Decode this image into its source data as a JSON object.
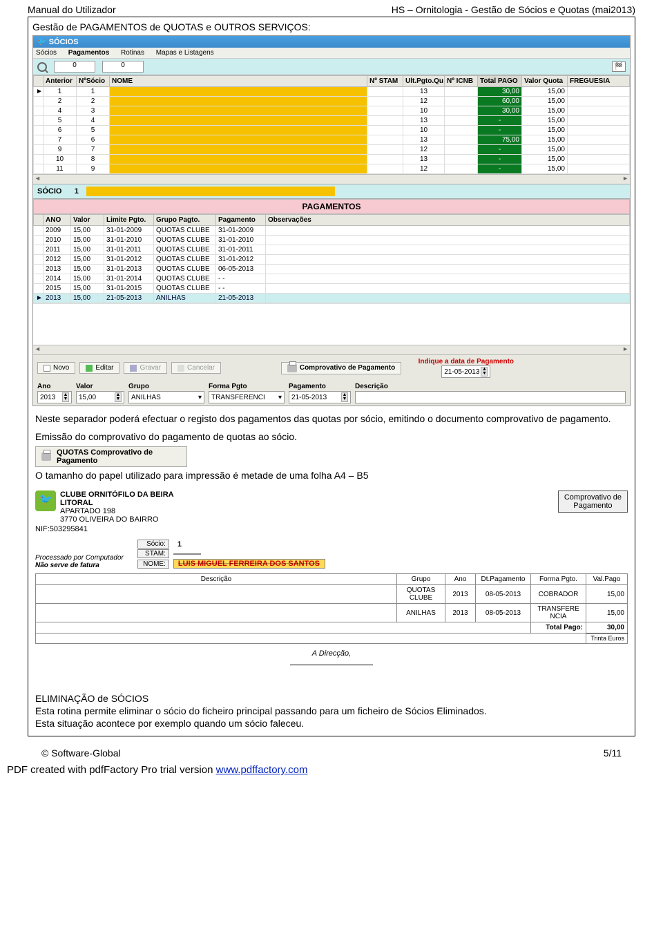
{
  "header": {
    "left": "Manual do Utilizador",
    "right": "HS – Ornitologia - Gestão de Sócios e Quotas (mai2013)"
  },
  "section_heading": "Gestão de PAGAMENTOS de QUOTAS e OUTROS SERVIÇOS:",
  "app": {
    "title": "SÓCIOS",
    "menus": [
      "Sócios",
      "Pagamentos",
      "Rotinas",
      "Mapas e Listagens"
    ],
    "filters": {
      "f1": "0",
      "f2": "0"
    },
    "columns": [
      "Anterior",
      "NºSócio",
      "NOME",
      "Nº STAM",
      "Ult.Pgto.Qu",
      "Nº ICNB",
      "Total PAGO",
      "Valor Quota",
      "FREGUESIA"
    ],
    "rows": [
      {
        "marker": "►",
        "anterior": "1",
        "nsocio": "1",
        "stam": "",
        "ult": "13",
        "icnb": "",
        "total": "30,00",
        "vq": "15,00"
      },
      {
        "marker": "",
        "anterior": "2",
        "nsocio": "2",
        "stam": "",
        "ult": "12",
        "icnb": "",
        "total": "60,00",
        "vq": "15,00"
      },
      {
        "marker": "",
        "anterior": "4",
        "nsocio": "3",
        "stam": "",
        "ult": "10",
        "icnb": "",
        "total": "30,00",
        "vq": "15,00"
      },
      {
        "marker": "",
        "anterior": "5",
        "nsocio": "4",
        "stam": "",
        "ult": "13",
        "icnb": "",
        "total": "-",
        "vq": "15,00"
      },
      {
        "marker": "",
        "anterior": "6",
        "nsocio": "5",
        "stam": "",
        "ult": "10",
        "icnb": "",
        "total": "-",
        "vq": "15,00"
      },
      {
        "marker": "",
        "anterior": "7",
        "nsocio": "6",
        "stam": "",
        "ult": "13",
        "icnb": "",
        "total": "75,00",
        "vq": "15,00"
      },
      {
        "marker": "",
        "anterior": "9",
        "nsocio": "7",
        "stam": "",
        "ult": "12",
        "icnb": "",
        "total": "-",
        "vq": "15,00"
      },
      {
        "marker": "",
        "anterior": "10",
        "nsocio": "8",
        "stam": "",
        "ult": "13",
        "icnb": "",
        "total": "-",
        "vq": "15,00"
      },
      {
        "marker": "",
        "anterior": "11",
        "nsocio": "9",
        "stam": "",
        "ult": "12",
        "icnb": "",
        "total": "-",
        "vq": "15,00"
      }
    ],
    "socio_label": "SÓCIO",
    "socio_num": "1",
    "pag_header": "PAGAMENTOS",
    "pay_columns": [
      "ANO",
      "Valor",
      "Limite Pgto.",
      "Grupo Pagto.",
      "Pagamento",
      "Observações"
    ],
    "pay_rows": [
      {
        "ano": "2009",
        "valor": "15,00",
        "limite": "31-01-2009",
        "grupo": "QUOTAS CLUBE",
        "pag": "31-01-2009",
        "obs": ""
      },
      {
        "ano": "2010",
        "valor": "15,00",
        "limite": "31-01-2010",
        "grupo": "QUOTAS CLUBE",
        "pag": "31-01-2010",
        "obs": ""
      },
      {
        "ano": "2011",
        "valor": "15,00",
        "limite": "31-01-2011",
        "grupo": "QUOTAS CLUBE",
        "pag": "31-01-2011",
        "obs": ""
      },
      {
        "ano": "2012",
        "valor": "15,00",
        "limite": "31-01-2012",
        "grupo": "QUOTAS CLUBE",
        "pag": "31-01-2012",
        "obs": ""
      },
      {
        "ano": "2013",
        "valor": "15,00",
        "limite": "31-01-2013",
        "grupo": "QUOTAS CLUBE",
        "pag": "06-05-2013",
        "obs": ""
      },
      {
        "ano": "2014",
        "valor": "15,00",
        "limite": "31-01-2014",
        "grupo": "QUOTAS CLUBE",
        "pag": "- -",
        "obs": ""
      },
      {
        "ano": "2015",
        "valor": "15,00",
        "limite": "31-01-2015",
        "grupo": "QUOTAS CLUBE",
        "pag": "- -",
        "obs": ""
      },
      {
        "ano": "2013",
        "valor": "15,00",
        "limite": "21-05-2013",
        "grupo": "ANILHAS",
        "pag": "21-05-2013",
        "obs": "",
        "selected": true
      }
    ],
    "buttons": {
      "novo": "Novo",
      "editar": "Editar",
      "gravar": "Gravar",
      "cancelar": "Cancelar",
      "comprov": "Comprovativo de Pagamento"
    },
    "note": {
      "line1": "Indique a data de Pagamento",
      "date": "21-05-2013"
    },
    "entry": {
      "labels": {
        "ano": "Ano",
        "valor": "Valor",
        "grupo": "Grupo",
        "forma": "Forma Pgto",
        "pag": "Pagamento",
        "desc": "Descrição"
      },
      "values": {
        "ano": "2013",
        "valor": "15,00",
        "grupo": "ANILHAS",
        "forma": "TRANSFERENCI",
        "pag": "21-05-2013",
        "desc": ""
      }
    }
  },
  "para1": "Neste separador poderá efectuar o registo dos pagamentos das quotas por sócio, emitindo o documento comprovativo de pagamento.",
  "para2": "Emissão do comprovativo do pagamento de quotas ao sócio.",
  "snippet_btn": {
    "line1": "QUOTAS Comprovativo de",
    "line2": "Pagamento"
  },
  "para3": "O tamanho do papel utilizado para impressão  é metade de uma folha A4 – B5",
  "receipt": {
    "club_name1": "CLUBE ORNITÓFILO DA BEIRA",
    "club_name2": "LITORAL",
    "addr1": "APARTADO 198",
    "addr2": "3770 OLIVEIRA DO BAIRRO",
    "nif": "NIF:503295841",
    "comp1": "Comprovativo de",
    "comp2": "Pagamento",
    "labels": {
      "socio": "Sócio:",
      "stam": "STAM:",
      "nome": "NOME:"
    },
    "values": {
      "socio": "1",
      "stam": "",
      "nome": "LUIS MIGUEL FERREIRA DOS SANTOS"
    },
    "proc": "Processado por Computador",
    "nao": "Não serve de fatura",
    "columns": [
      "Descrição",
      "Grupo",
      "Ano",
      "Dt.Pagamento",
      "Forma Pgto.",
      "Val.Pago"
    ],
    "rows": [
      {
        "desc": "",
        "grupo": "QUOTAS CLUBE",
        "ano": "2013",
        "dt": "08-05-2013",
        "forma": "COBRADOR",
        "val": "15,00"
      },
      {
        "desc": "",
        "grupo": "ANILHAS",
        "ano": "2013",
        "dt": "08-05-2013",
        "forma": "TRANSFERE NCIA",
        "val": "15,00"
      }
    ],
    "total_label": "Total Pago:",
    "total_value": "30,00",
    "total_unit": "Trinta Euros",
    "direccao": "A Direcção,"
  },
  "elim_heading": "ELIMINAÇÃO de SÓCIOS",
  "elim_p1": "Esta rotina permite eliminar o sócio do ficheiro principal passando para um ficheiro de Sócios Eliminados.",
  "elim_p2": "Esta situação acontece por exemplo quando um sócio faleceu.",
  "footer": {
    "left": "© Software-Global",
    "right": "5/11"
  },
  "pdf": {
    "prefix": "PDF created with pdfFactory Pro trial version ",
    "link": "www.pdffactory.com"
  }
}
